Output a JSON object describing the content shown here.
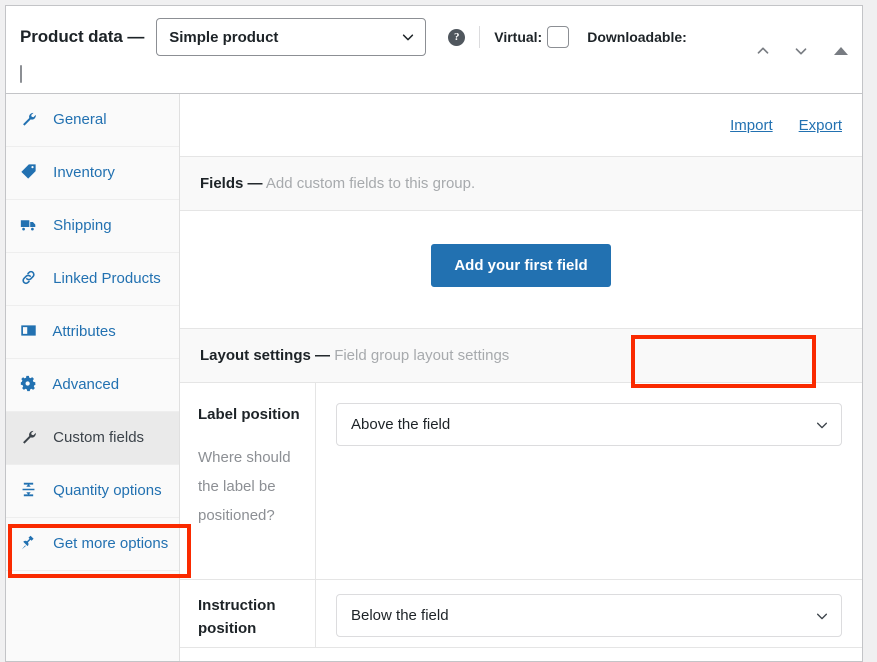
{
  "panel": {
    "title": "Product data —",
    "product_type": {
      "selected": "Simple product",
      "icon": "chevron-down-icon"
    },
    "help_glyph": "?",
    "virtual": {
      "label": "Virtual:",
      "checked": false
    },
    "downloadable": {
      "label": "Downloadable:",
      "checked": false
    },
    "handles": {
      "move_up": "chevron-up-icon",
      "move_down": "chevron-down-icon",
      "toggle": "triangle-up-icon"
    }
  },
  "sidebar": {
    "items": [
      {
        "label": "General",
        "icon": "wrench-icon",
        "active": false
      },
      {
        "label": "Inventory",
        "icon": "archive-icon",
        "active": false
      },
      {
        "label": "Shipping",
        "icon": "truck-icon",
        "active": false
      },
      {
        "label": "Linked Products",
        "icon": "link-icon",
        "active": false
      },
      {
        "label": "Attributes",
        "icon": "list-card-icon",
        "active": false
      },
      {
        "label": "Advanced",
        "icon": "gear-icon",
        "active": false
      },
      {
        "label": "Custom fields",
        "icon": "wrench-icon",
        "active": true
      },
      {
        "label": "Quantity options",
        "icon": "quantity-icon",
        "active": false
      },
      {
        "label": "Get more options",
        "icon": "plugin-icon",
        "active": false
      }
    ]
  },
  "toolbar": {
    "import_label": "Import",
    "export_label": "Export"
  },
  "fields_section": {
    "heading_strong": "Fields —",
    "heading_muted": "Add custom fields to this group.",
    "add_first_field_label": "Add your first field"
  },
  "layout_section": {
    "heading_strong": "Layout settings —",
    "heading_muted": "Field group layout settings",
    "rows": [
      {
        "label": "Label position",
        "description": "Where should the label be positioned?",
        "value": "Above the field",
        "icon": "chevron-down-icon"
      },
      {
        "label": "Instruction position",
        "description": "",
        "value": "Below the field",
        "icon": "chevron-down-icon"
      }
    ]
  },
  "colors": {
    "accent_blue": "#2271b1",
    "annotation_red": "#fa2a00",
    "muted_text": "#a7aaad",
    "panel_border": "#c3c4c7"
  }
}
